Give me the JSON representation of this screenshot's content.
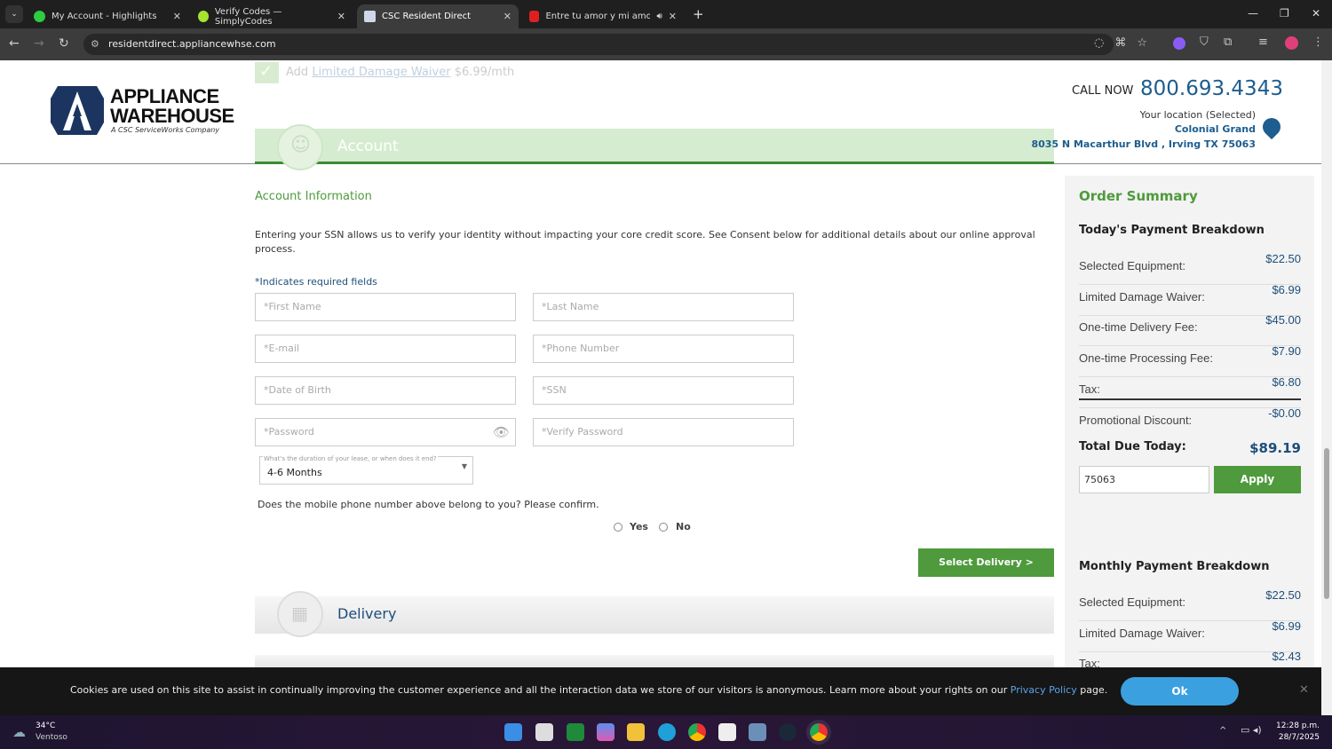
{
  "browser": {
    "tabs": [
      {
        "label": "My Account - Highlights",
        "color": "#2ecc40"
      },
      {
        "label": "Verify Codes — SimplyCodes",
        "color": "#a6e22e"
      },
      {
        "label": "CSC Resident Direct",
        "color": "#cfd8e8"
      },
      {
        "label": "Entre tu amor y mi amor - (",
        "color": "#e02020"
      }
    ],
    "url": "residentdirect.appliancewhse.com"
  },
  "header": {
    "logo_line1": "APPLIANCE",
    "logo_line2": "WAREHOUSE",
    "logo_tagline": "A CSC ServiceWorks Company",
    "call_label": "CALL NOW",
    "phone": "800.693.4343",
    "location_label": "Your location (Selected)",
    "location_name": "Colonial Grand",
    "location_address": "8035 N Macarthur Blvd , Irving TX 75063"
  },
  "waiver": {
    "prefix": "Add",
    "link": "Limited Damage Waiver",
    "price": "$6.99/mth"
  },
  "account_step": {
    "title": "Account"
  },
  "form": {
    "section_title": "Account Information",
    "intro": "Entering your SSN allows us to verify your identity without impacting your core credit score. See Consent below for additional details about our online approval process.",
    "required_note": "*Indicates required fields",
    "first_name": "*First Name",
    "last_name": "*Last Name",
    "email": "*E-mail",
    "phone": "*Phone Number",
    "dob": "*Date of Birth",
    "ssn": "*SSN",
    "password": "*Password",
    "verify_password": "*Verify Password",
    "lease_label": "What's the duration of your lease, or when does it end?",
    "lease_value": "4-6 Months",
    "phone_confirm": "Does the mobile phone number above belong to you? Please confirm.",
    "yes": "Yes",
    "no": "No",
    "next_button": "Select Delivery >"
  },
  "delivery_step": {
    "title": "Delivery"
  },
  "summary": {
    "title": "Order Summary",
    "today_title": "Today's Payment Breakdown",
    "today_rows": [
      {
        "label": "Selected Equipment:",
        "value": "$22.50"
      },
      {
        "label": "Limited Damage Waiver:",
        "value": "$6.99"
      },
      {
        "label": "One-time Delivery Fee:",
        "value": "$45.00"
      },
      {
        "label": "One-time Processing Fee:",
        "value": "$7.90"
      },
      {
        "label": "Tax:",
        "value": "$6.80"
      },
      {
        "label": "Promotional Discount:",
        "value": "-$0.00"
      }
    ],
    "total_label": "Total Due Today:",
    "total_value": "$89.19",
    "promo_value": "75063",
    "apply": "Apply",
    "monthly_title": "Monthly Payment Breakdown",
    "monthly_rows": [
      {
        "label": "Selected Equipment:",
        "value": "$22.50"
      },
      {
        "label": "Limited Damage Waiver:",
        "value": "$6.99"
      },
      {
        "label": "Tax:",
        "value": "$2.43"
      }
    ]
  },
  "cookie": {
    "text": "Cookies are used on this site to assist in continually improving the customer experience and all the interaction data we store of our visitors is anonymous. Learn more about your rights on our",
    "link": "Privacy Policy",
    "suffix": "page.",
    "ok": "Ok"
  },
  "taskbar": {
    "weather_temp": "34°C",
    "weather_desc": "Ventoso",
    "time": "12:28 p.m.",
    "date": "28/7/2025"
  }
}
